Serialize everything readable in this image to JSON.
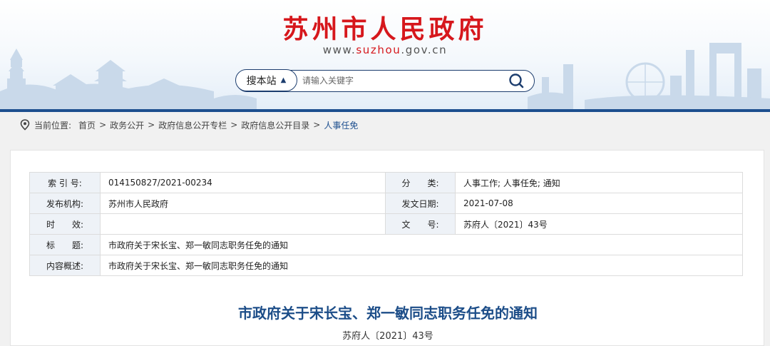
{
  "header": {
    "title": "苏州市人民政府",
    "url_prefix": "www.",
    "url_brand": "suzhou",
    "url_suffix": ".gov.cn",
    "accent_color": "#d6171c"
  },
  "search": {
    "scope_label": "搜本站",
    "scope_arrow": "▲",
    "placeholder": "请输入关键字",
    "icon": "search-icon"
  },
  "breadcrumb": {
    "icon": "location-pin-icon",
    "prefix": "当前位置:",
    "items": [
      "首页",
      "政务公开",
      "政府信息公开专栏",
      "政府信息公开目录",
      "人事任免"
    ],
    "separator": ">"
  },
  "meta": {
    "index_label": "索 引 号:",
    "index_value": "014150827/2021-00234",
    "category_label": "分　　类:",
    "category_value": "人事工作;  人事任免;  通知",
    "issuer_label": "发布机构:",
    "issuer_value": "苏州市人民政府",
    "date_label": "发文日期:",
    "date_value": "2021-07-08",
    "validity_label": "时　　效:",
    "validity_value": "",
    "docno_label": "文　　号:",
    "docno_value": "苏府人〔2021〕43号",
    "title_label": "标　　题:",
    "title_value": "市政府关于宋长宝、郑一敏同志职务任免的通知",
    "summary_label": "内容概述:",
    "summary_value": "市政府关于宋长宝、郑一敏同志职务任免的通知"
  },
  "document": {
    "title": "市政府关于宋长宝、郑一敏同志职务任免的通知",
    "number": "苏府人〔2021〕43号"
  },
  "colors": {
    "primary_blue": "#1d4f8f",
    "label_bg": "#eef2f7"
  }
}
